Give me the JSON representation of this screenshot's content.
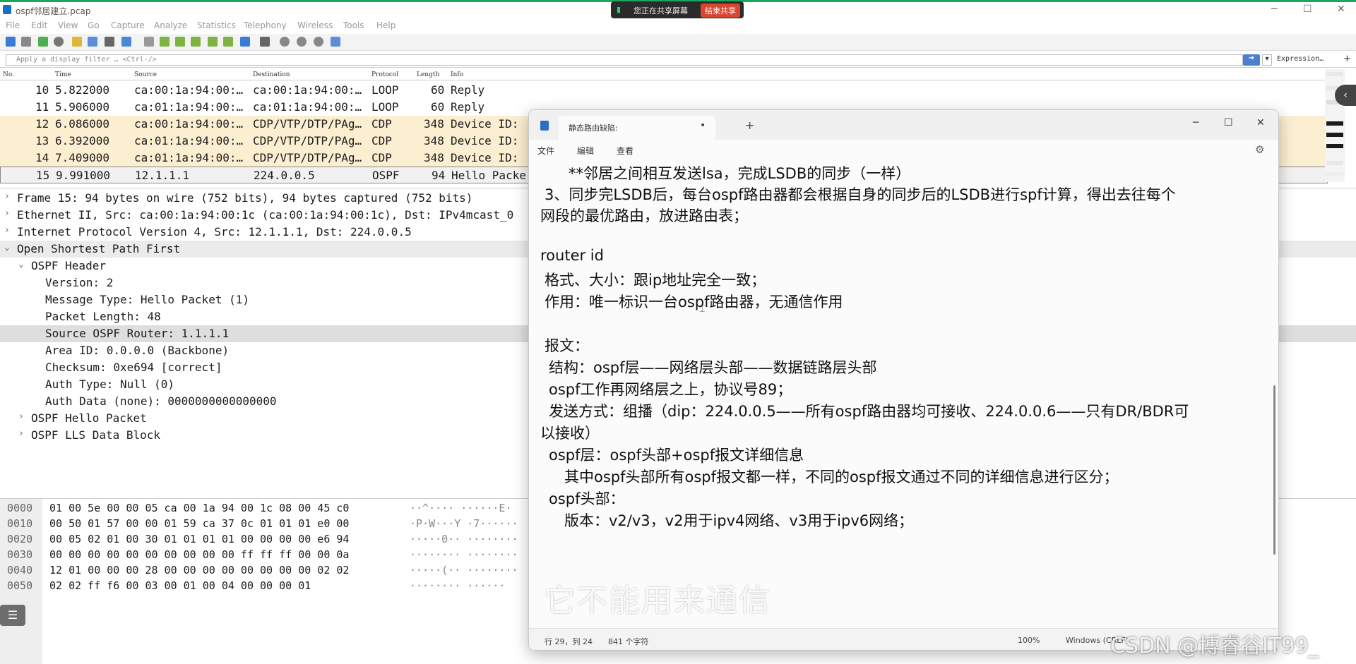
{
  "window": {
    "title": "ospf邻居建立.pcap"
  },
  "share": {
    "text": "您正在共享屏幕",
    "stop": "结束共享"
  },
  "menu": [
    "File",
    "Edit",
    "View",
    "Go",
    "Capture",
    "Analyze",
    "Statistics",
    "Telephony",
    "Wireless",
    "Tools",
    "Help"
  ],
  "filter": {
    "placeholder": "Apply a display filter … <Ctrl-/>",
    "expression": "Expression…",
    "add": "+"
  },
  "packet_list": {
    "headers": [
      "No.",
      "Time",
      "Source",
      "Destination",
      "Protocol",
      "Length",
      "Info"
    ],
    "rows": [
      {
        "no": "10",
        "time": "5.822000",
        "src": "ca:00:1a:94:00:…",
        "dst": "ca:00:1a:94:00:…",
        "proto": "LOOP",
        "len": "60",
        "info": "Reply"
      },
      {
        "no": "11",
        "time": "5.906000",
        "src": "ca:01:1a:94:00:…",
        "dst": "ca:01:1a:94:00:…",
        "proto": "LOOP",
        "len": "60",
        "info": "Reply"
      },
      {
        "no": "12",
        "time": "6.086000",
        "src": "ca:00:1a:94:00:…",
        "dst": "CDP/VTP/DTP/PAg…",
        "proto": "CDP",
        "len": "348",
        "info": "Device ID:"
      },
      {
        "no": "13",
        "time": "6.392000",
        "src": "ca:01:1a:94:00:…",
        "dst": "CDP/VTP/DTP/PAg…",
        "proto": "CDP",
        "len": "348",
        "info": "Device ID:"
      },
      {
        "no": "14",
        "time": "7.409000",
        "src": "ca:01:1a:94:00:…",
        "dst": "CDP/VTP/DTP/PAg…",
        "proto": "CDP",
        "len": "348",
        "info": "Device ID:"
      },
      {
        "no": "15",
        "time": "9.991000",
        "src": "12.1.1.1",
        "dst": "224.0.0.5",
        "proto": "OSPF",
        "len": "94",
        "info": "Hello Packe"
      }
    ]
  },
  "details": [
    {
      "arrow": "›",
      "text": "Frame 15: 94 bytes on wire (752 bits), 94 bytes captured (752 bits)"
    },
    {
      "arrow": "›",
      "text": "Ethernet II, Src: ca:00:1a:94:00:1c (ca:00:1a:94:00:1c), Dst: IPv4mcast_0"
    },
    {
      "arrow": "›",
      "text": "Internet Protocol Version 4, Src: 12.1.1.1, Dst: 224.0.0.5"
    },
    {
      "arrow": "⌄",
      "text": "Open Shortest Path First"
    },
    {
      "arrow": "⌄",
      "text": "OSPF Header"
    },
    {
      "arrow": "",
      "text": "Version: 2"
    },
    {
      "arrow": "",
      "text": "Message Type: Hello Packet (1)"
    },
    {
      "arrow": "",
      "text": "Packet Length: 48"
    },
    {
      "arrow": "",
      "text": "Source OSPF Router: 1.1.1.1"
    },
    {
      "arrow": "",
      "text": "Area ID: 0.0.0.0 (Backbone)"
    },
    {
      "arrow": "",
      "text": "Checksum: 0xe694 [correct]"
    },
    {
      "arrow": "",
      "text": "Auth Type: Null (0)"
    },
    {
      "arrow": "",
      "text": "Auth Data (none): 0000000000000000"
    },
    {
      "arrow": "›",
      "text": "OSPF Hello Packet"
    },
    {
      "arrow": "›",
      "text": "OSPF LLS Data Block"
    }
  ],
  "hex": [
    {
      "off": "0000",
      "bytes": "01 00 5e 00 00 05 ca 00  1a 94 00 1c 08 00 45 c0",
      "ascii": "··^····  ······E·"
    },
    {
      "off": "0010",
      "bytes": "00 50 01 57 00 00 01 59  ca 37 0c 01 01 01 e0 00",
      "ascii": "·P·W···Y ·7······"
    },
    {
      "off": "0020",
      "bytes": "00 05 02 01 00 30 01 01  01 01 00 00 00 00 e6 94",
      "ascii": "·····0·· ········"
    },
    {
      "off": "0030",
      "bytes": "00 00 00 00 00 00 00 00  00 00 ff ff ff 00 00 0a",
      "ascii": "········ ········"
    },
    {
      "off": "0040",
      "bytes": "12 01 00 00 00 28 00 00  00 00 00 00 00 00 02 02",
      "ascii": "·····(·· ········"
    },
    {
      "off": "0050",
      "bytes": "02 02 ff f6 00 03 00 01  00 04 00 00 00 01",
      "ascii": "········ ······"
    }
  ],
  "notepad": {
    "tab": "静态路由缺陷:",
    "menu": [
      "文件",
      "编辑",
      "查看"
    ],
    "lines": [
      "**邻居之间相互发送lsa，完成LSDB的同步（一样）",
      "3、同步完LSDB后，每台ospf路由器都会根据自身的同步后的LSDB进行spf计算，得出去往每个",
      "网段的最优路由，放进路由表；",
      "",
      "router id",
      "格式、大小：跟ip地址完全一致；",
      "作用：唯一标识一台ospf路由器，无通信作用",
      "",
      "报文：",
      "结构：ospf层——网络层头部——数据链路层头部",
      "ospf工作再网络层之上，协议号89；",
      "发送方式：组播（dip：224.0.0.5——所有ospf路由器均可接收、224.0.0.6——只有DR/BDR可",
      "以接收）",
      "ospf层：ospf头部+ospf报文详细信息",
      "其中ospf头部所有ospf报文都一样，不同的ospf报文通过不同的详细信息进行区分；",
      "ospf头部：",
      "版本：v2/v3，v2用于ipv4网络、v3用于ipv6网络；"
    ],
    "status": {
      "pos": "行 29，列 24",
      "chars": "841 个字符",
      "zoom": "100%",
      "eol": "Windows (CRLF)"
    }
  },
  "subtitle": "它不能用来通信",
  "watermark": "CSDN @博睿谷IT99_",
  "colors": {
    "cdp_row": "#fbeed1",
    "selected_row": "#f1f1f1",
    "accent": "#1aa85c"
  }
}
